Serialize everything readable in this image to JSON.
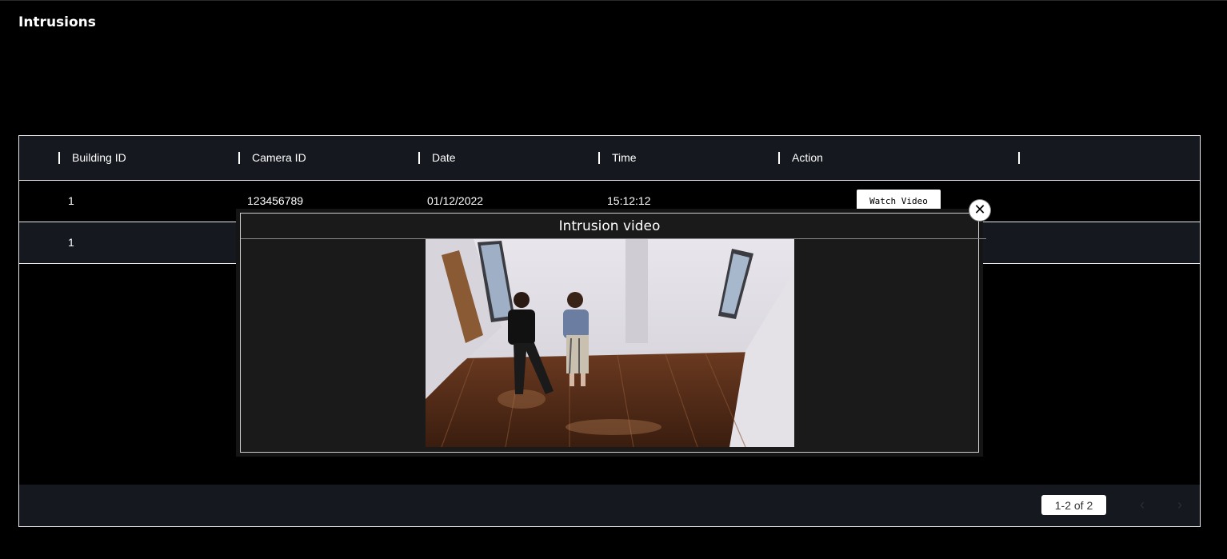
{
  "page": {
    "title": "Intrusions"
  },
  "table": {
    "columns": [
      "Building ID",
      "Camera ID",
      "Date",
      "Time",
      "Action"
    ],
    "rows": [
      {
        "building_id": "1",
        "camera_id": "123456789",
        "date": "01/12/2022",
        "time": "15:12:12",
        "action_label": "Watch Video"
      },
      {
        "building_id": "1"
      }
    ]
  },
  "footer": {
    "page_info": "1-2 of 2",
    "prev_icon": "chevron-left-icon",
    "next_icon": "chevron-right-icon"
  },
  "modal": {
    "title": "Intrusion video",
    "close_symbol": "✕",
    "close_icon": "close-icon"
  },
  "colors": {
    "background": "#000000",
    "header_bg": "#161820",
    "modal_bg": "#1a1a1a",
    "border": "#e8e8e8"
  }
}
